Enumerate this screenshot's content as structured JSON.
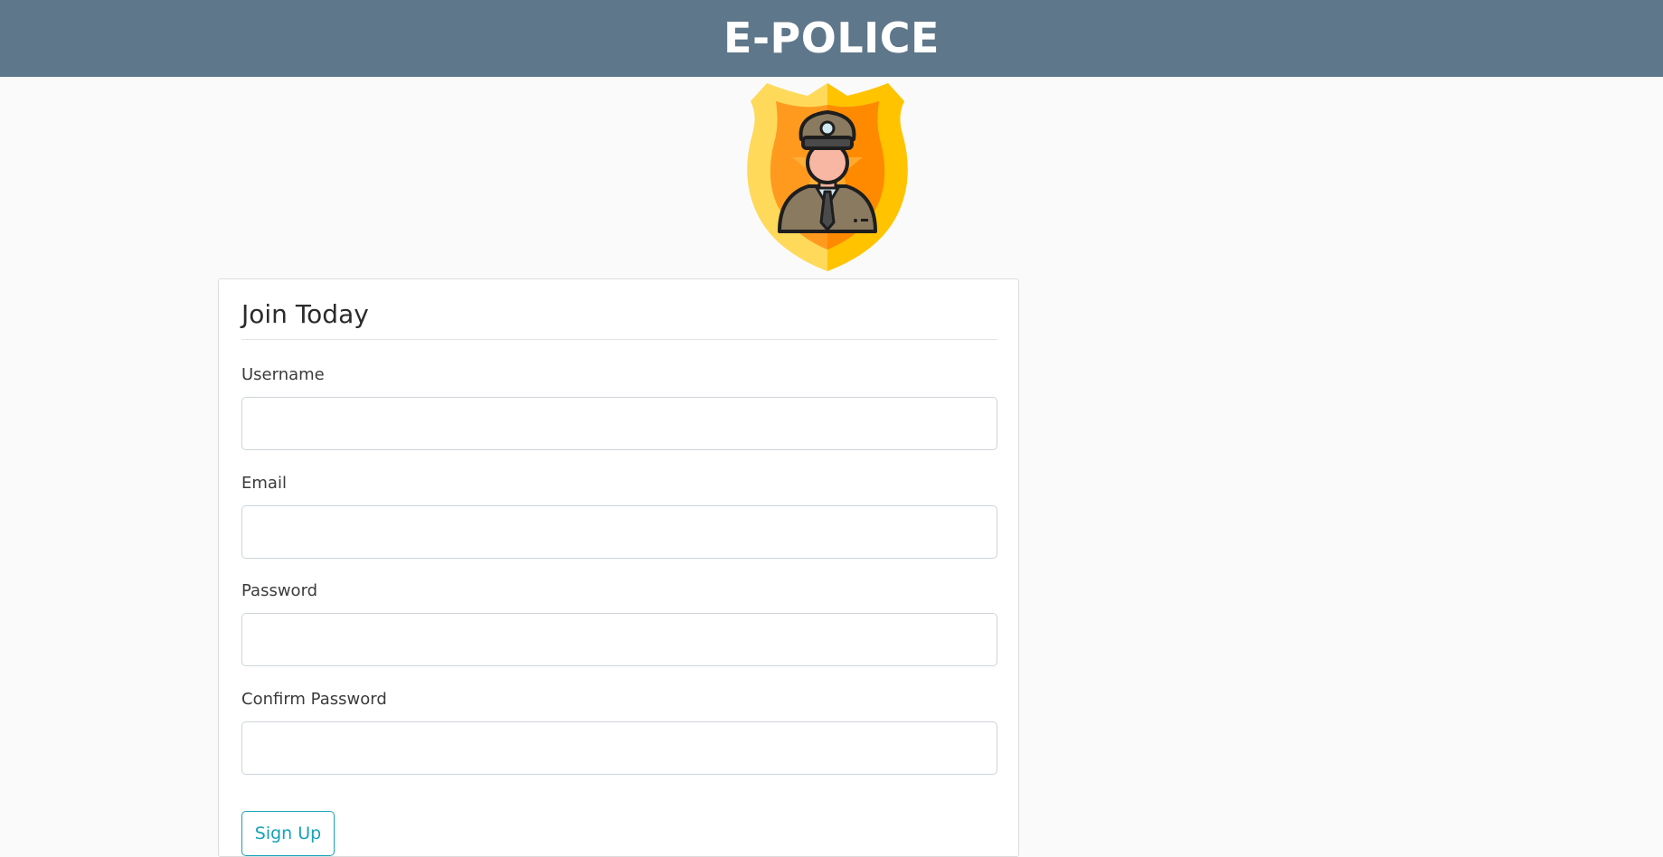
{
  "header": {
    "brand": "E-POLICE",
    "background_color": "#5f778a"
  },
  "logo": {
    "icon": "police-officer-badge-icon"
  },
  "form": {
    "legend": "Join Today",
    "fields": [
      {
        "label": "Username",
        "value": "",
        "placeholder": ""
      },
      {
        "label": "Email",
        "value": "",
        "placeholder": ""
      },
      {
        "label": "Password",
        "value": "",
        "placeholder": ""
      },
      {
        "label": "Confirm Password",
        "value": "",
        "placeholder": ""
      }
    ],
    "submit_label": "Sign Up",
    "accent_color": "#17a2b8"
  }
}
